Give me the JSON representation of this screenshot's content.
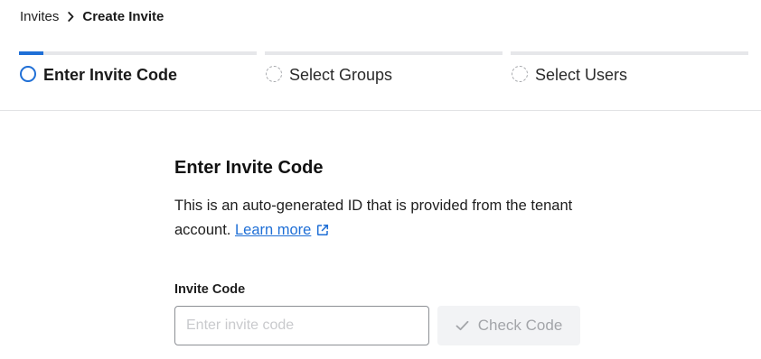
{
  "breadcrumb": {
    "parent": "Invites",
    "current": "Create Invite"
  },
  "steps": [
    {
      "label": "Enter Invite Code",
      "state": "active"
    },
    {
      "label": "Select Groups",
      "state": "pending"
    },
    {
      "label": "Select Users",
      "state": "pending"
    }
  ],
  "section": {
    "title": "Enter Invite Code",
    "description": "This is an auto-generated ID that is provided from the tenant account.",
    "learn_more": "Learn more"
  },
  "form": {
    "invite_code_label": "Invite Code",
    "invite_code_placeholder": "Enter invite code",
    "invite_code_value": "",
    "check_button": "Check Code"
  },
  "colors": {
    "accent": "#1f6fd6",
    "disabled_text": "#a3a5a9"
  }
}
